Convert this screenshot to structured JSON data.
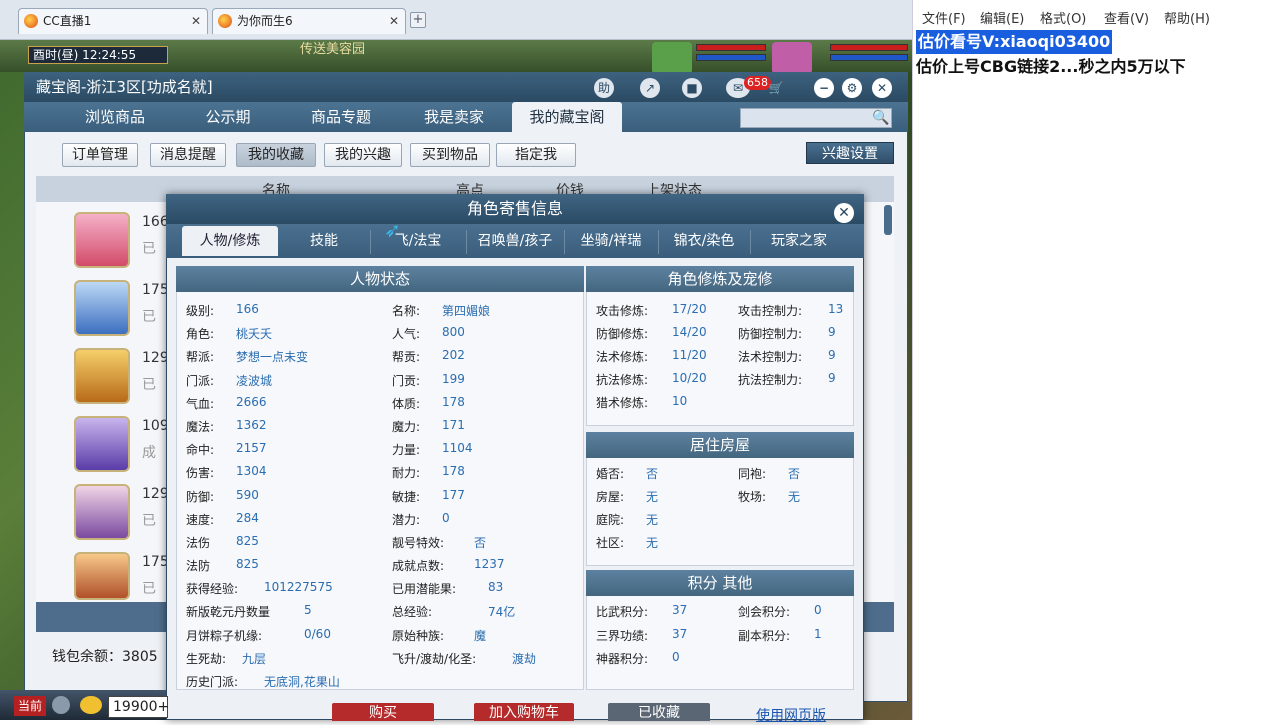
{
  "browser_tabs": [
    {
      "label": "CC直播1"
    },
    {
      "label": "为你而生6"
    }
  ],
  "game_clock": "酉时(昼) 12:24:55",
  "game_scene_text": "传送美容园",
  "window": {
    "title": "藏宝阁-浙江3区[功成名就]",
    "help": "助",
    "msg_count": "658"
  },
  "nav_tabs": [
    {
      "label": "浏览商品"
    },
    {
      "label": "公示期"
    },
    {
      "label": "商品专题"
    },
    {
      "label": "我是卖家"
    },
    {
      "label": "我的藏宝阁"
    }
  ],
  "sub_buttons": [
    {
      "label": "订单管理"
    },
    {
      "label": "消息提醒"
    },
    {
      "label": "我的收藏"
    },
    {
      "label": "我的兴趣"
    },
    {
      "label": "买到物品"
    },
    {
      "label": "指定我"
    }
  ],
  "interest_button": "兴趣设置",
  "list_headers": {
    "name": "名称",
    "server": "高点",
    "price": "价钱",
    "status": "上架状态"
  },
  "list_rows": [
    {
      "lvl": "166",
      "st": "已"
    },
    {
      "lvl": "175",
      "st": "已"
    },
    {
      "lvl": "129",
      "st": "已"
    },
    {
      "lvl": "109",
      "st": "成"
    },
    {
      "lvl": "129",
      "st": "已"
    },
    {
      "lvl": "175",
      "st": "已"
    }
  ],
  "wallet": "钱包余额：3805",
  "popup": {
    "title": "角色寄售信息",
    "tabs": [
      {
        "label": "人物/修炼"
      },
      {
        "label": "技能"
      },
      {
        "label": "飞/法宝"
      },
      {
        "label": "召唤兽/孩子"
      },
      {
        "label": "坐骑/祥瑞"
      },
      {
        "label": "锦衣/染色"
      },
      {
        "label": "玩家之家"
      }
    ],
    "status_title": "人物状态",
    "status_left": [
      {
        "k": "级别:",
        "v": "166"
      },
      {
        "k": "角色:",
        "v": "桃夭夭"
      },
      {
        "k": "帮派:",
        "v": "梦想一点未变"
      },
      {
        "k": "门派:",
        "v": "凌波城"
      },
      {
        "k": "气血:",
        "v": "2666"
      },
      {
        "k": "魔法:",
        "v": "1362"
      },
      {
        "k": "命中:",
        "v": "2157"
      },
      {
        "k": "伤害:",
        "v": "1304"
      },
      {
        "k": "防御:",
        "v": "590"
      },
      {
        "k": "速度:",
        "v": "284"
      },
      {
        "k": "法伤",
        "v": "825"
      },
      {
        "k": "法防",
        "v": "825"
      }
    ],
    "status_right": [
      {
        "k": "名称:",
        "v": "第四媚娘"
      },
      {
        "k": "人气:",
        "v": "800"
      },
      {
        "k": "帮贡:",
        "v": "202"
      },
      {
        "k": "门贡:",
        "v": "199"
      },
      {
        "k": "体质:",
        "v": "178"
      },
      {
        "k": "魔力:",
        "v": "171"
      },
      {
        "k": "力量:",
        "v": "1104"
      },
      {
        "k": "耐力:",
        "v": "178"
      },
      {
        "k": "敏捷:",
        "v": "177"
      },
      {
        "k": "潜力:",
        "v": "0"
      },
      {
        "k": "靓号特效:",
        "v": "否"
      },
      {
        "k": "成就点数:",
        "v": "1237"
      }
    ],
    "status_extra": [
      {
        "k": "获得经验:",
        "v": "101227575"
      },
      {
        "k": "已用潜能果:",
        "v": "83"
      },
      {
        "k": "新版乾元丹数量",
        "v": "5"
      },
      {
        "k": "总经验:",
        "v": "74亿"
      },
      {
        "k": "月饼粽子机缘:",
        "v": "0/60"
      },
      {
        "k": "原始种族:",
        "v": "魔"
      },
      {
        "k": "生死劫:",
        "v": "九层"
      },
      {
        "k": "飞升/渡劫/化圣:",
        "v": "渡劫"
      },
      {
        "k": "历史门派:",
        "v": "无底洞,花果山"
      }
    ],
    "cultivation_title": "角色修炼及宠修",
    "cultivation_left": [
      {
        "k": "攻击修炼:",
        "v": "17/20"
      },
      {
        "k": "防御修炼:",
        "v": "14/20"
      },
      {
        "k": "法术修炼:",
        "v": "11/20"
      },
      {
        "k": "抗法修炼:",
        "v": "10/20"
      },
      {
        "k": "猎术修炼:",
        "v": "10"
      }
    ],
    "cultivation_right": [
      {
        "k": "攻击控制力:",
        "v": "13"
      },
      {
        "k": "防御控制力:",
        "v": "9"
      },
      {
        "k": "法术控制力:",
        "v": "9"
      },
      {
        "k": "抗法控制力:",
        "v": "9"
      }
    ],
    "house_title": "居住房屋",
    "house": [
      {
        "k": "婚否:",
        "v": "否"
      },
      {
        "k": "同袍:",
        "v": "否"
      },
      {
        "k": "房屋:",
        "v": "无"
      },
      {
        "k": "牧场:",
        "v": "无"
      },
      {
        "k": "庭院:",
        "v": "无"
      },
      {
        "k": "社区:",
        "v": "无"
      }
    ],
    "score_title": "积分 其他",
    "score": [
      {
        "k": "比武积分:",
        "v": "37"
      },
      {
        "k": "剑会积分:",
        "v": "0"
      },
      {
        "k": "三界功绩:",
        "v": "37"
      },
      {
        "k": "副本积分:",
        "v": "1"
      },
      {
        "k": "神器积分:",
        "v": "0"
      }
    ],
    "buttons": {
      "buy": "购买",
      "cart": "加入购物车",
      "fav": "已收藏",
      "web": "使用网页版"
    }
  },
  "game_bar": {
    "current": "当前",
    "money": "19900+"
  },
  "notepad": {
    "menu": [
      {
        "label": "文件(F)"
      },
      {
        "label": "编辑(E)"
      },
      {
        "label": "格式(O)"
      },
      {
        "label": "查看(V)"
      },
      {
        "label": "帮助(H)"
      }
    ],
    "line1": "估价看号V:xiaoqi03400",
    "line2": "估价上号CBG链接2...秒之内5万以下"
  },
  "colors": {
    "accent": "#2b4a63",
    "value": "#2a6db0",
    "buy": "#b52a2a",
    "highlight": "#1a5ee0"
  }
}
